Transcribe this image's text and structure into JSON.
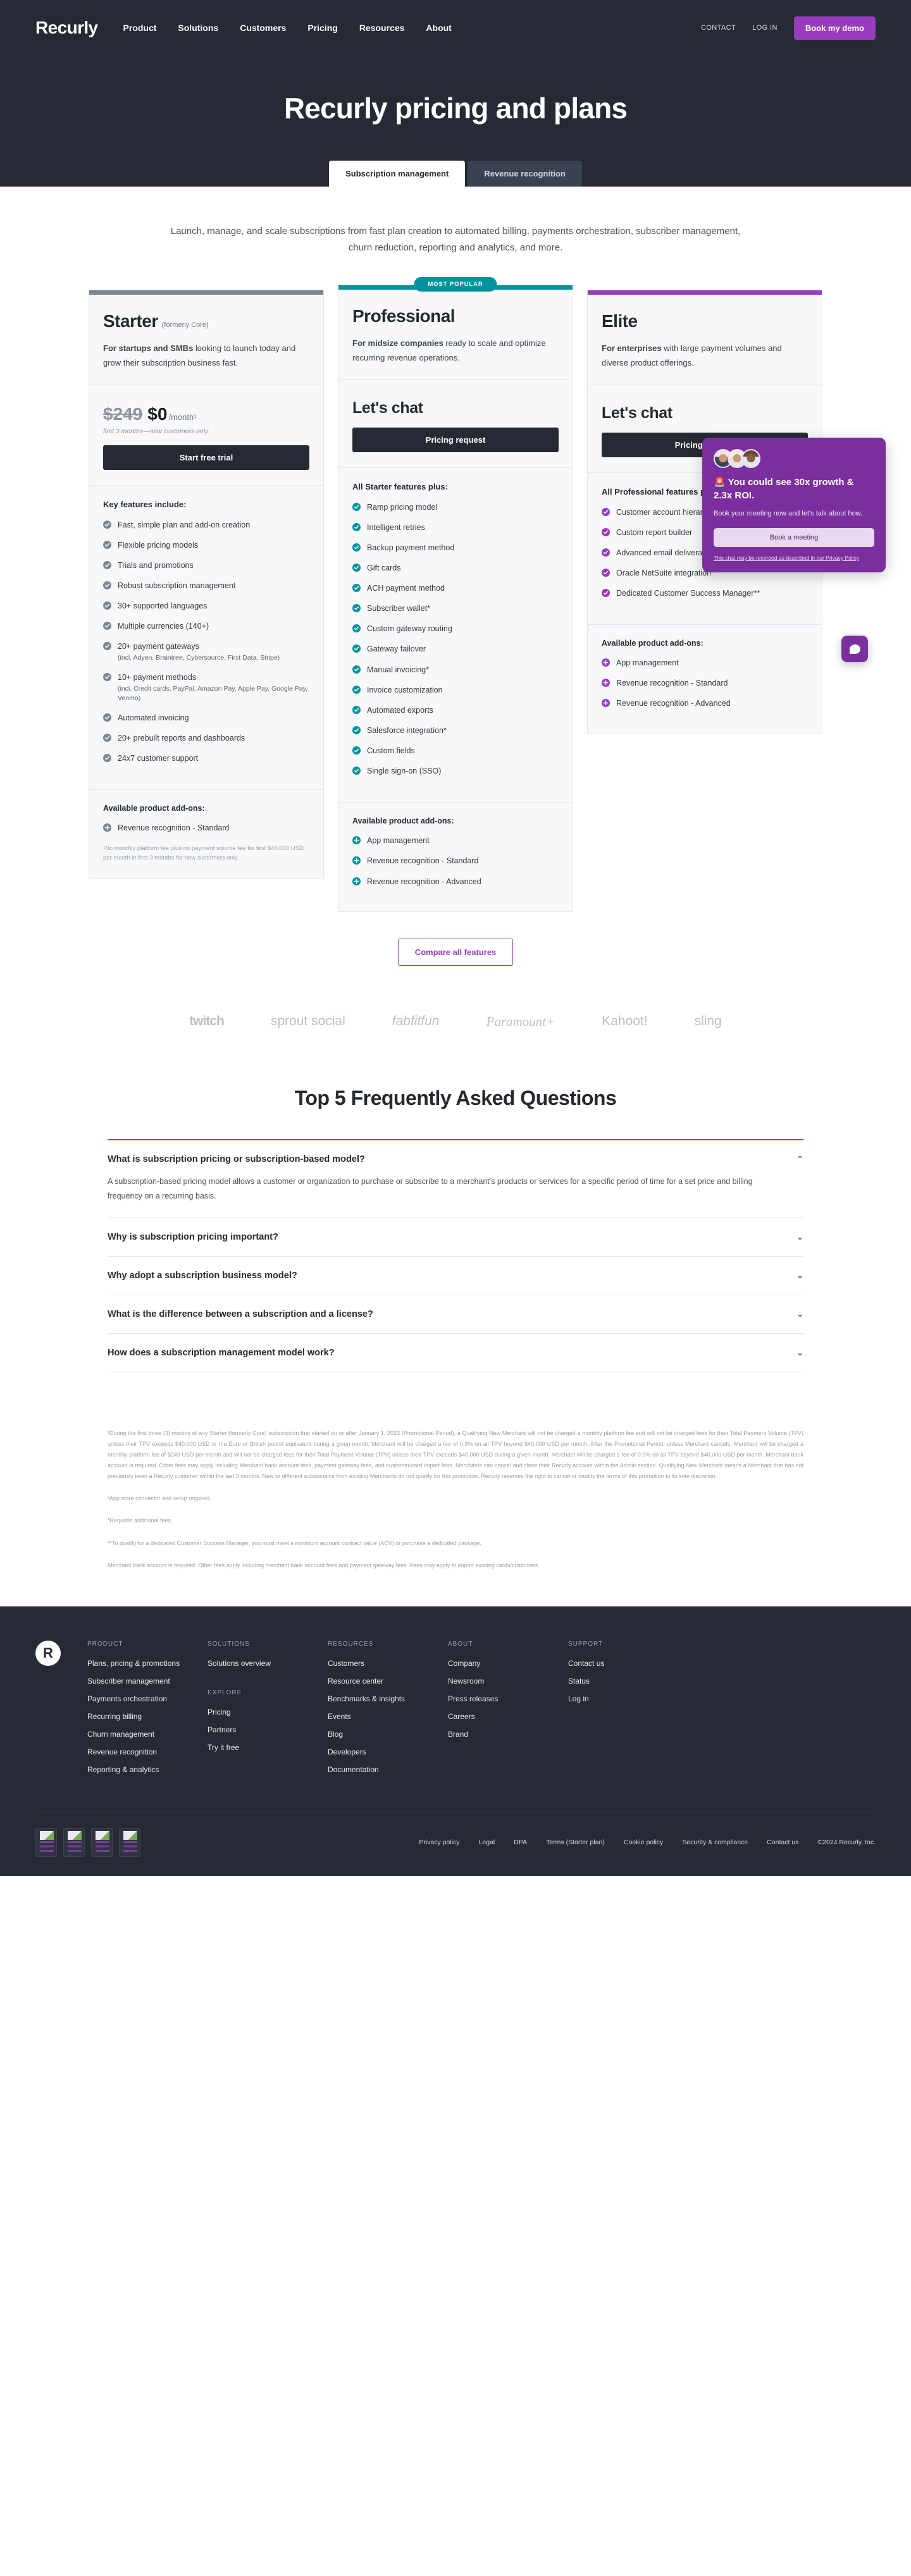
{
  "header": {
    "logo": "Recurly",
    "nav": [
      "Product",
      "Solutions",
      "Customers",
      "Pricing",
      "Resources",
      "About"
    ],
    "contact": "CONTACT",
    "login": "LOG IN",
    "demo_button": "Book my demo"
  },
  "hero": {
    "title": "Recurly pricing and plans",
    "tabs": [
      {
        "label": "Subscription management",
        "active": true
      },
      {
        "label": "Revenue recognition",
        "active": false
      }
    ]
  },
  "intro": "Launch, manage, and scale subscriptions from fast plan creation to automated billing, payments orchestration, subscriber management, churn reduction, reporting and analytics, and more.",
  "plans": [
    {
      "name": "Starter",
      "name_sub": "(formerly Core)",
      "accent": "#7b8694",
      "badge": null,
      "desc_bold": "For startups and SMBs",
      "desc_rest": " looking to launch today and grow their subscription business fast.",
      "price_old": "$249",
      "price_new": "$0",
      "price_per": "/month¹",
      "price_note": "first 3 months—new customers only",
      "price_headline": null,
      "cta": "Start free trial",
      "features_title": "Key features include:",
      "features": [
        {
          "text": "Fast, simple plan and add-on creation"
        },
        {
          "text": "Flexible pricing models"
        },
        {
          "text": "Trials and promotions"
        },
        {
          "text": "Robust subscription management"
        },
        {
          "text": "30+ supported languages"
        },
        {
          "text": "Multiple currencies (140+)"
        },
        {
          "text": "20+ payment gateways",
          "sub": "(incl. Adyen, Braintree, Cybersource, First Data, Stripe)"
        },
        {
          "text": "10+ payment methods",
          "sub": "(incl. Credit cards, PayPal, Amazon Pay, Apple Pay, Google Pay, Venmo)"
        },
        {
          "text": "Automated invoicing"
        },
        {
          "text": "20+ prebuilt reports and dashboards"
        },
        {
          "text": "24x7 customer support"
        }
      ],
      "addons_title": "Available product add-ons:",
      "addons": [
        "Revenue recognition - Standard"
      ],
      "fineprint": "¹No monthly platform fee plus no payment volume fee for first $40,000 USD per month in first 3 months for new customers only."
    },
    {
      "name": "Professional",
      "name_sub": null,
      "accent": "#00939e",
      "badge": "MOST POPULAR",
      "desc_bold": "For midsize companies",
      "desc_rest": " ready to scale and optimize recurring revenue operations.",
      "price_old": null,
      "price_new": null,
      "price_per": null,
      "price_note": null,
      "price_headline": "Let's chat",
      "cta": "Pricing request",
      "features_title": "All Starter features plus:",
      "features": [
        {
          "text": "Ramp pricing model"
        },
        {
          "text": "Intelligent retries"
        },
        {
          "text": "Backup payment method"
        },
        {
          "text": "Gift cards"
        },
        {
          "text": "ACH payment method"
        },
        {
          "text": "Subscriber wallet*"
        },
        {
          "text": "Custom gateway routing"
        },
        {
          "text": "Gateway failover"
        },
        {
          "text": "Manual invoicing*"
        },
        {
          "text": "Invoice customization"
        },
        {
          "text": "Automated exports"
        },
        {
          "text": "Salesforce integration*"
        },
        {
          "text": "Custom fields"
        },
        {
          "text": "Single sign-on (SSO)"
        }
      ],
      "addons_title": "Available product add-ons:",
      "addons": [
        "App management",
        "Revenue recognition - Standard",
        "Revenue recognition - Advanced"
      ],
      "fineprint": null
    },
    {
      "name": "Elite",
      "name_sub": null,
      "accent": "#963cbd",
      "badge": null,
      "desc_bold": "For enterprises",
      "desc_rest": " with large payment volumes and diverse product offerings.",
      "price_old": null,
      "price_new": null,
      "price_per": null,
      "price_note": null,
      "price_headline": "Let's chat",
      "cta": "Pricing request",
      "features_title": "All Professional features plus:",
      "features": [
        {
          "text": "Customer account hierarchy"
        },
        {
          "text": "Custom report builder"
        },
        {
          "text": "Advanced email deliverability*"
        },
        {
          "text": "Oracle NetSuite integration*"
        },
        {
          "text": "Dedicated Customer Success Manager**"
        }
      ],
      "addons_title": "Available product add-ons:",
      "addons": [
        "App management",
        "Revenue recognition - Standard",
        "Revenue recognition - Advanced"
      ],
      "fineprint": null
    }
  ],
  "compare_button": "Compare all features",
  "logos": [
    "twitch",
    "sprout social",
    "fabfitfun",
    "Paramount+",
    "Kahoot!",
    "sling"
  ],
  "faq": {
    "title": "Top 5 Frequently Asked Questions",
    "items": [
      {
        "question": "What is subscription pricing or subscription-based model?",
        "answer": "A subscription-based pricing model allows a customer or organization to purchase or subscribe to a merchant's products or services for a specific period of time for a set price and billing frequency on a recurring basis.",
        "open": true
      },
      {
        "question": "Why is subscription pricing important?",
        "answer": "",
        "open": false
      },
      {
        "question": "Why adopt a subscription business model?",
        "answer": "",
        "open": false
      },
      {
        "question": "What is the difference between a subscription and a license?",
        "answer": "",
        "open": false
      },
      {
        "question": "How does a subscription management model work?",
        "answer": "",
        "open": false
      }
    ]
  },
  "footnotes": [
    "¹During the first three (3) months of any Starter (formerly Core) subscription that started on or after January 1, 2023 (Promotional Period), a Qualifying New Merchant will not be charged a monthly platform fee and will not be charged fees for their Total Payment Volume (TPV) unless their TPV exceeds $40,000 USD or the Euro or British pound equivalent during a given month; Merchant will be charged a fee of 0.9% on all TPV beyond $40,000 USD per month. After the Promotional Period, unless Merchant cancels, Merchant will be charged a monthly platform fee of $249 USD per month and will not be charged fees for their Total Payment Volume (TPV) unless their TPV exceeds $40,000 USD during a given month; Merchant will be charged a fee of 0.9% on all TPV beyond $40,000 USD per month. Merchant bank account is required. Other fees may apply including Merchant bank account fees, payment gateway fees, and customer/card import fees. Merchants can cancel and close their Recurly account within the Admin section. Qualifying New Merchant means a Merchant that has not previously been a Recurly customer within the last 3 months. New or different subdomains from existing Merchants do not qualify for this promotion. Recurly reserves the right to cancel or modify the terms of this promotion in its sole discretion.",
    "²App store connector and setup required.",
    "*Requires additional fees.",
    "**To qualify for a dedicated Customer Success Manager, you must meet a minimum account contract value (ACV) or purchase a dedicated package.",
    "Merchant bank account is required. Other fees apply including merchant bank account fees and payment gateway fees. Fees may apply to import existing cards/customers"
  ],
  "footer": {
    "columns": [
      {
        "heading": "PRODUCT",
        "links": [
          "Plans, pricing & promotions",
          "Subscriber management",
          "Payments orchestration",
          "Recurring billing",
          "Churn management",
          "Revenue recognition",
          "Reporting & analytics"
        ]
      },
      {
        "heading": "SOLUTIONS",
        "links": [
          "Solutions overview"
        ],
        "heading2": "EXPLORE",
        "links2": [
          "Pricing",
          "Partners",
          "Try it free"
        ]
      },
      {
        "heading": "RESOURCES",
        "links": [
          "Customers",
          "Resource center",
          "Benchmarks & insights",
          "Events",
          "Blog",
          "Developers",
          "Documentation"
        ]
      },
      {
        "heading": "ABOUT",
        "links": [
          "Company",
          "Newsroom",
          "Press releases",
          "Careers",
          "Brand"
        ]
      },
      {
        "heading": "SUPPORT",
        "links": [
          "Contact us",
          "Status",
          "Log in"
        ]
      }
    ],
    "legal": [
      "Privacy policy",
      "Legal",
      "DPA",
      "Terms (Starter plan)",
      "Cookie policy",
      "Security & compliance",
      "Contact us"
    ],
    "copyright": "©2024 Recurly, Inc."
  },
  "chat": {
    "headline": "🚨 You could see 30x growth & 2.3x ROI.",
    "sub": "Book your meeting now and let's talk about how.",
    "button": "Book a meeting",
    "legal_a": "This chat may be recorded as described in our ",
    "legal_b": "Privacy Policy"
  }
}
